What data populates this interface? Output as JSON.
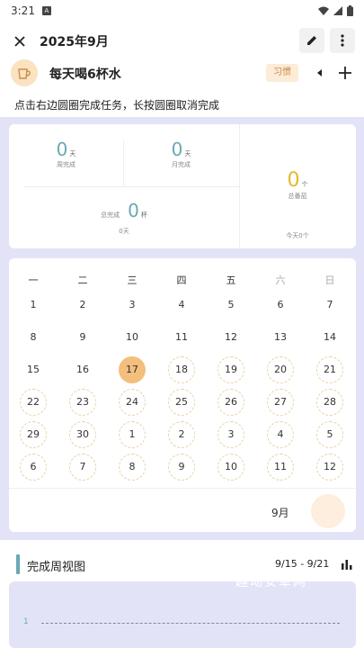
{
  "status": {
    "time": "3:21",
    "badge": "A"
  },
  "header": {
    "title": "2025年9月"
  },
  "habit": {
    "name": "每天喝6杯水",
    "tag": "习惯"
  },
  "hint": "点击右边圆圈完成任务，长按圆圈取消完成",
  "stats": {
    "week": {
      "value": "0",
      "unit": "天",
      "label": "周完成"
    },
    "month": {
      "value": "0",
      "unit": "天",
      "label": "月完成"
    },
    "total": {
      "prefix": "总完成",
      "value": "0",
      "unit": "杯",
      "sub": "0天"
    },
    "streak": {
      "value": "0",
      "unit": "个",
      "label": "总番茄",
      "sub": "今天0个"
    }
  },
  "calendar": {
    "weekdays": [
      "一",
      "二",
      "三",
      "四",
      "五",
      "六",
      "日"
    ],
    "weeks": [
      [
        "1",
        "2",
        "3",
        "4",
        "5",
        "6",
        "7"
      ],
      [
        "8",
        "9",
        "10",
        "11",
        "12",
        "13",
        "14"
      ],
      [
        "15",
        "16",
        "17",
        "18",
        "19",
        "20",
        "21"
      ],
      [
        "22",
        "23",
        "24",
        "25",
        "26",
        "27",
        "28"
      ],
      [
        "29",
        "30",
        "1",
        "2",
        "3",
        "4",
        "5"
      ],
      [
        "6",
        "7",
        "8",
        "9",
        "10",
        "11",
        "12"
      ]
    ],
    "today": "17",
    "month_label": "9月"
  },
  "weekly": {
    "title": "完成周视图",
    "range": "9/15 - 9/21"
  },
  "chart_axis_tick": "1",
  "watermark": "趣动安卓网",
  "colors": {
    "accent": "#6aa8b4",
    "today": "#f4be7c",
    "panel": "#e3e3f8",
    "tag_text": "#c79048"
  }
}
